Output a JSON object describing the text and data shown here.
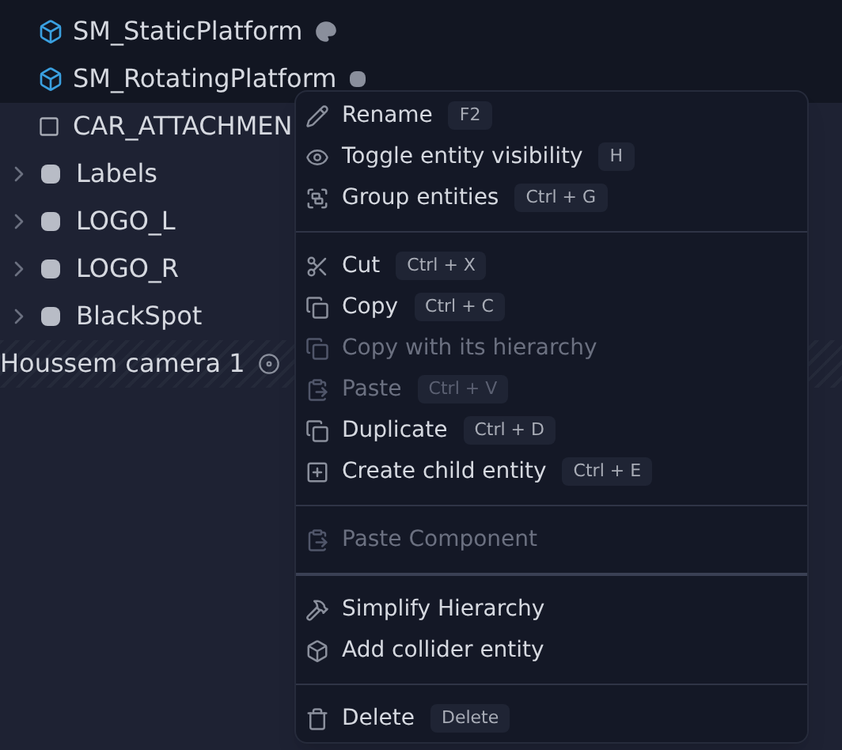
{
  "tree": {
    "rows": [
      {
        "kind": "mesh",
        "label": "SM_StaticPlatform",
        "selected": true
      },
      {
        "kind": "mesh",
        "label": "SM_RotatingPlatform",
        "selected": true
      },
      {
        "kind": "outline",
        "label": "CAR_ATTACHMEN",
        "selected": false
      },
      {
        "kind": "folder",
        "label": "Labels",
        "selected": false
      },
      {
        "kind": "folder",
        "label": "LOGO_L",
        "selected": false
      },
      {
        "kind": "folder",
        "label": "LOGO_R",
        "selected": false
      },
      {
        "kind": "folder",
        "label": "BlackSpot",
        "selected": false
      },
      {
        "kind": "camera",
        "label": "Houssem camera 1",
        "selected": false
      }
    ]
  },
  "context_menu": {
    "items": [
      {
        "kind": "item",
        "label": "Rename",
        "shortcut": "F2",
        "disabled": false
      },
      {
        "kind": "item",
        "label": "Toggle entity visibility",
        "shortcut": "H",
        "disabled": false
      },
      {
        "kind": "item",
        "label": "Group entities",
        "shortcut": "Ctrl + G",
        "disabled": false
      },
      {
        "kind": "divider"
      },
      {
        "kind": "item",
        "label": "Cut",
        "shortcut": "Ctrl + X",
        "disabled": false
      },
      {
        "kind": "item",
        "label": "Copy",
        "shortcut": "Ctrl + C",
        "disabled": false
      },
      {
        "kind": "item",
        "label": "Copy with its hierarchy",
        "disabled": true
      },
      {
        "kind": "item",
        "label": "Paste",
        "shortcut": "Ctrl + V",
        "disabled": true
      },
      {
        "kind": "item",
        "label": "Duplicate",
        "shortcut": "Ctrl + D",
        "disabled": false
      },
      {
        "kind": "item",
        "label": "Create child entity",
        "shortcut": "Ctrl + E",
        "disabled": false
      },
      {
        "kind": "divider"
      },
      {
        "kind": "item",
        "label": "Paste Component",
        "disabled": true
      },
      {
        "kind": "section-divider"
      },
      {
        "kind": "item",
        "label": "Simplify Hierarchy",
        "disabled": false
      },
      {
        "kind": "item",
        "label": "Add collider entity",
        "disabled": false
      },
      {
        "kind": "divider"
      },
      {
        "kind": "item",
        "label": "Delete",
        "shortcut": "Delete",
        "disabled": false
      }
    ]
  }
}
